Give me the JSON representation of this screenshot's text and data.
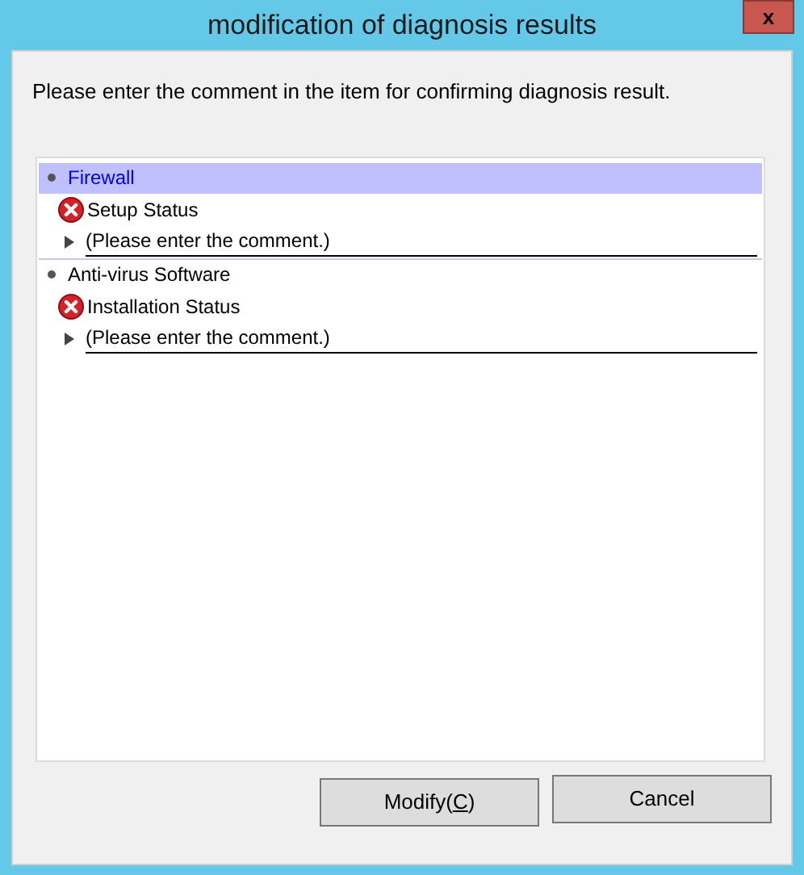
{
  "window": {
    "title": "modification of diagnosis results",
    "close": "x"
  },
  "instruction": "Please enter the comment in the item for confirming diagnosis result.",
  "groups": [
    {
      "name": "Firewall",
      "selected": true,
      "items": [
        {
          "name": "Setup Status",
          "failed": true,
          "comment": {
            "placeholder": "(Please enter the comment.)"
          }
        }
      ]
    },
    {
      "name": "Anti-virus Software",
      "selected": false,
      "items": [
        {
          "name": "Installation Status",
          "failed": true,
          "comment": {
            "placeholder": "(Please enter the comment.)"
          }
        }
      ]
    }
  ],
  "buttons": [
    {
      "before": "Modify(",
      "mnemonic": "C",
      "after": ")"
    },
    {
      "before": "Cancel"
    }
  ]
}
